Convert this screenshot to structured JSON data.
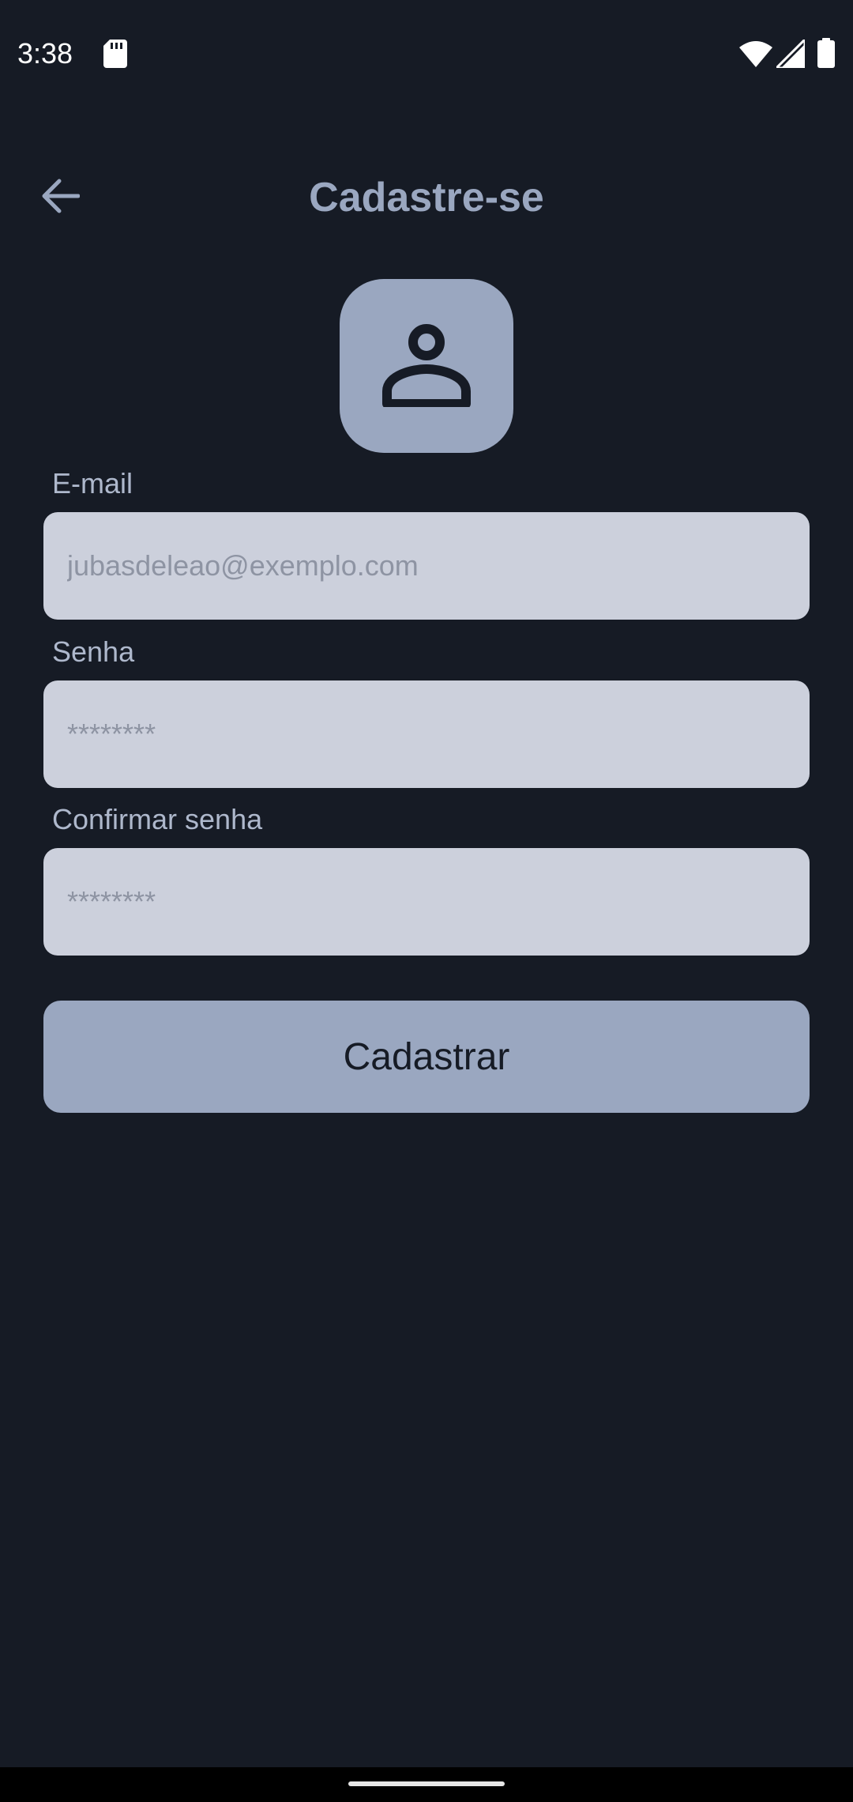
{
  "status_bar": {
    "time": "3:38",
    "icons": [
      "sd-card-icon",
      "wifi-icon",
      "signal-icon",
      "battery-icon"
    ]
  },
  "header": {
    "title": "Cadastre-se",
    "back_icon": "arrow-back-icon"
  },
  "avatar": {
    "icon": "person-icon"
  },
  "form": {
    "email": {
      "label": "E-mail",
      "placeholder": "jubasdeleao@exemplo.com",
      "value": ""
    },
    "password": {
      "label": "Senha",
      "placeholder": "********",
      "value": ""
    },
    "confirm_password": {
      "label": "Confirmar senha",
      "placeholder": "********",
      "value": ""
    },
    "submit_label": "Cadastrar"
  },
  "colors": {
    "background": "#161b25",
    "accent": "#9aa7c0",
    "input_background": "#ccd0dc",
    "title": "#9aa7c0",
    "label": "#aeb8cc"
  }
}
